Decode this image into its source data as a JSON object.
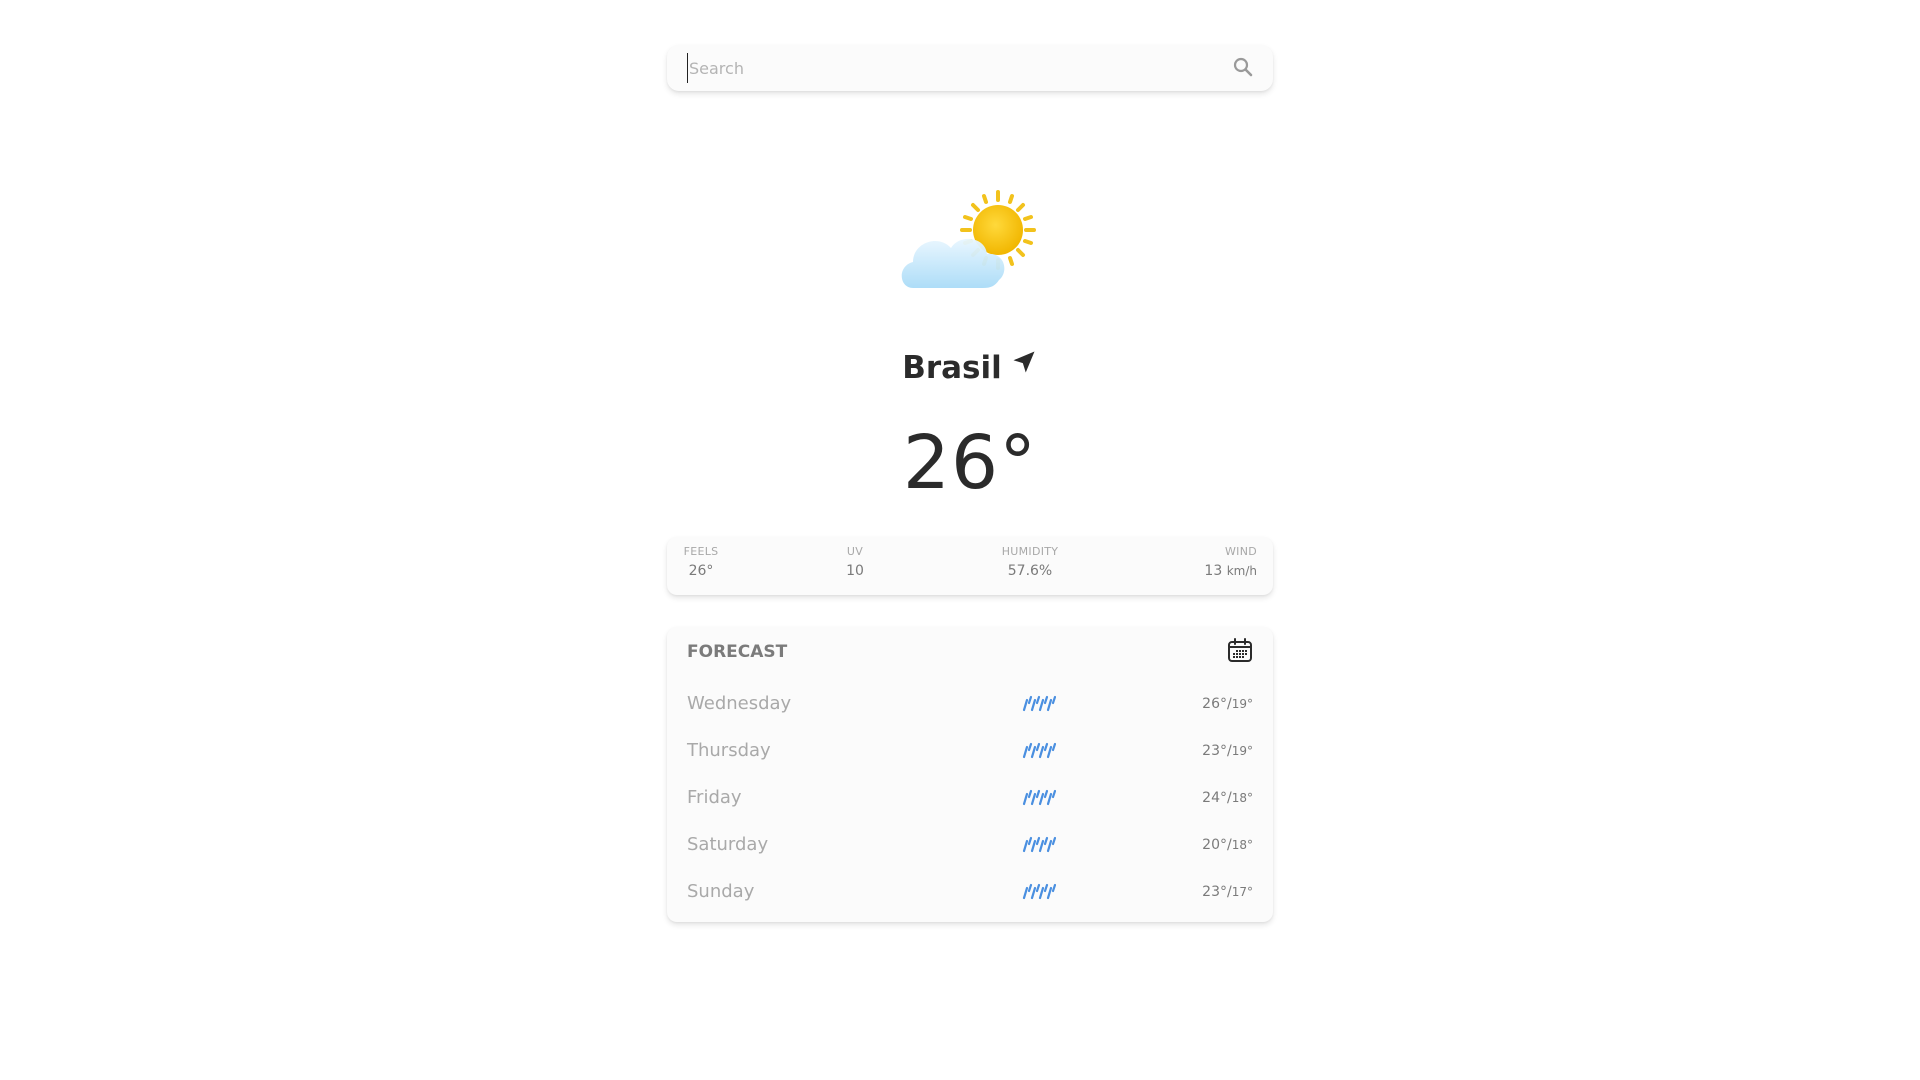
{
  "search": {
    "placeholder": "Search",
    "icon": "search-icon"
  },
  "current": {
    "icon": "partly-cloudy-icon",
    "city": "Brasil",
    "location_icon": "location-arrow-icon",
    "temperature": "26°"
  },
  "stats": [
    {
      "label": "FEELS",
      "value": "26°",
      "unit": ""
    },
    {
      "label": "UV",
      "value": "10",
      "unit": ""
    },
    {
      "label": "HUMIDITY",
      "value": "57.6%",
      "unit": ""
    },
    {
      "label": "WIND",
      "value": "13",
      "unit": "km/h"
    }
  ],
  "forecast": {
    "title": "FORECAST",
    "calendar_icon": "calendar-icon",
    "days": [
      {
        "day": "Wednesday",
        "icon": "rain-icon",
        "high": "26°",
        "low": "19°"
      },
      {
        "day": "Thursday",
        "icon": "rain-icon",
        "high": "23°",
        "low": "19°"
      },
      {
        "day": "Friday",
        "icon": "rain-icon",
        "high": "24°",
        "low": "18°"
      },
      {
        "day": "Saturday",
        "icon": "rain-icon",
        "high": "20°",
        "low": "18°"
      },
      {
        "day": "Sunday",
        "icon": "rain-icon",
        "high": "23°",
        "low": "17°"
      }
    ]
  },
  "colors": {
    "sun": "#f6c21a",
    "cloud": "#bfe4fb",
    "rain": "#4a8fe0",
    "text_dark": "#2b2b2b",
    "text_muted": "#a9a9a9"
  }
}
